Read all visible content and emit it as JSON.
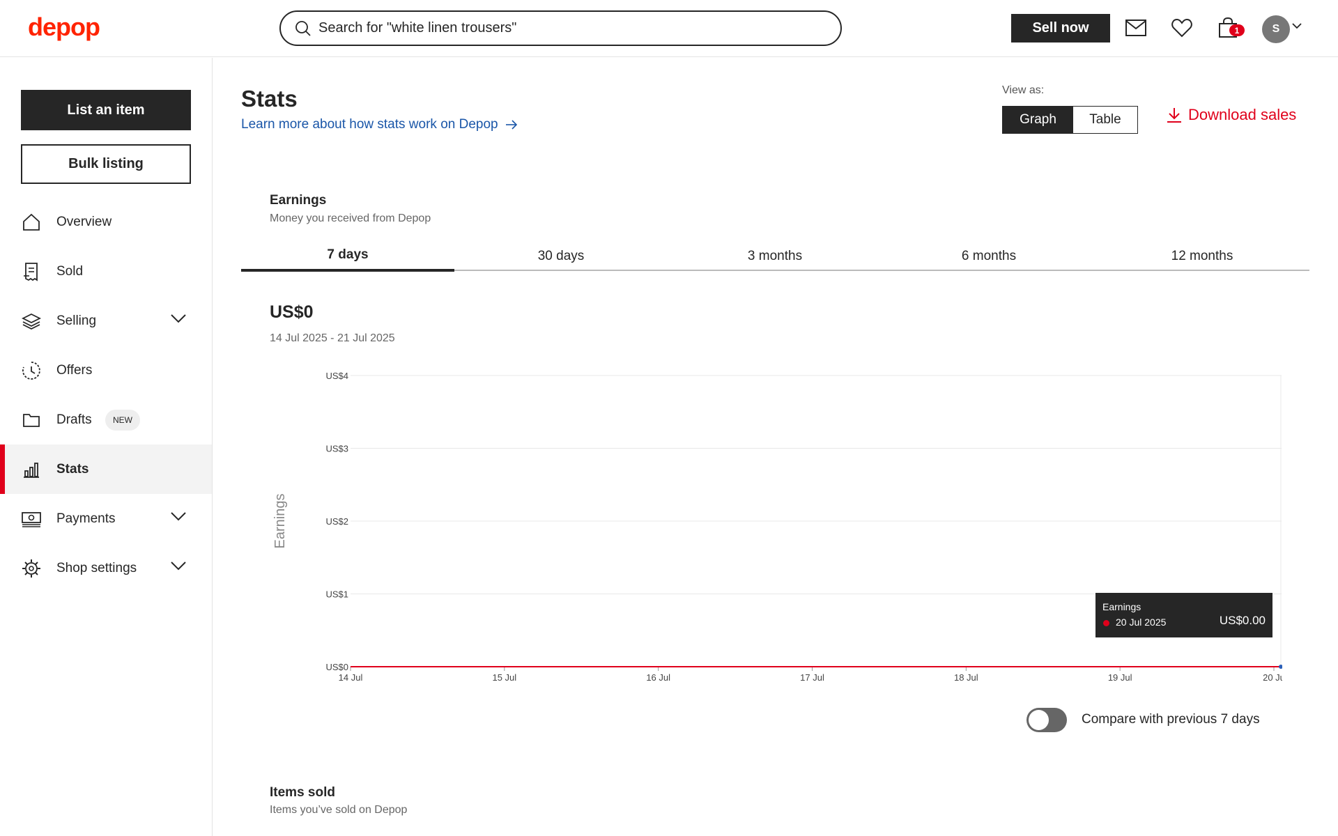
{
  "header": {
    "logo": "depop",
    "search_value": "Search for \"white linen trousers\"",
    "sell_now": "Sell now",
    "cart_count": "1",
    "avatar_initial": "S"
  },
  "sidebar": {
    "list_item": "List an item",
    "bulk_listing": "Bulk listing",
    "items": [
      {
        "label": "Overview"
      },
      {
        "label": "Sold"
      },
      {
        "label": "Selling"
      },
      {
        "label": "Offers"
      },
      {
        "label": "Drafts",
        "badge": "NEW"
      },
      {
        "label": "Stats"
      },
      {
        "label": "Payments"
      },
      {
        "label": "Shop settings"
      }
    ]
  },
  "main": {
    "title": "Stats",
    "learn_more": "Learn more about how stats work on Depop",
    "view_as_label": "View as:",
    "view_graph": "Graph",
    "view_table": "Table",
    "download": "Download sales",
    "earnings_title": "Earnings",
    "earnings_sub": "Money you received from Depop",
    "tabs": [
      "7 days",
      "30 days",
      "3 months",
      "6 months",
      "12 months"
    ],
    "amount": "US$0",
    "date_range": "14 Jul 2025 - 21 Jul 2025",
    "tooltip": {
      "title": "Earnings",
      "date": "20 Jul 2025",
      "value": "US$0.00"
    },
    "compare_label": "Compare with previous 7 days",
    "items_sold_title": "Items sold",
    "items_sold_sub": "Items you’ve sold on Depop"
  },
  "colors": {
    "brand": "#ff2300",
    "accent_red": "#e0001b",
    "dark": "#262626",
    "link": "#1a56a8"
  },
  "chart_data": {
    "type": "line",
    "ylabel": "Earnings",
    "x": [
      "14 Jul",
      "15 Jul",
      "16 Jul",
      "17 Jul",
      "18 Jul",
      "19 Jul",
      "20 Ju"
    ],
    "y_ticks": [
      "US$0",
      "US$1",
      "US$2",
      "US$3",
      "US$4"
    ],
    "ylim": [
      0,
      4
    ],
    "series": [
      {
        "values": [
          0,
          0,
          0,
          0,
          0,
          0,
          0
        ],
        "color": "#e0001b"
      }
    ],
    "grid": true
  }
}
